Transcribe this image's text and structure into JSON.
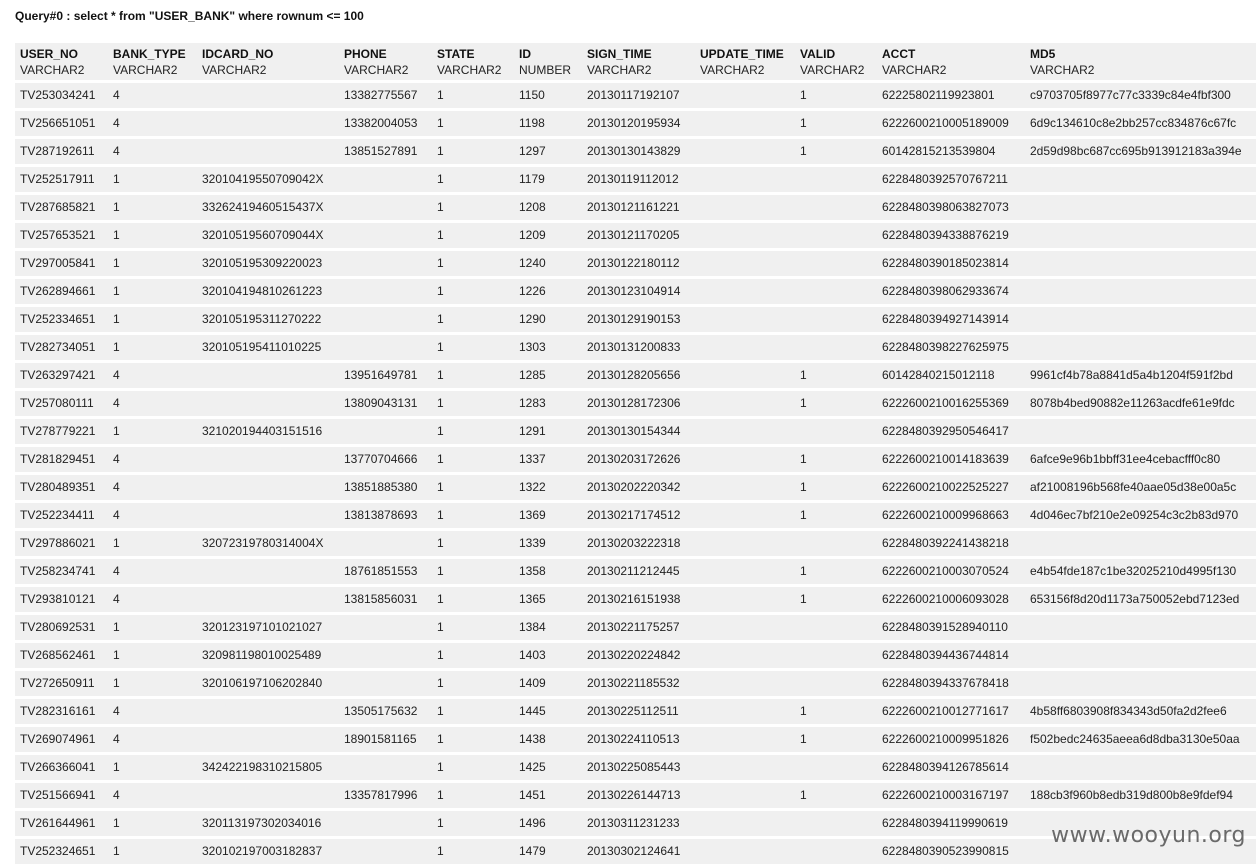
{
  "query": {
    "title": "Query#0 : select * from \"USER_BANK\" where rownum <= 100"
  },
  "table": {
    "columns": [
      {
        "name": "USER_NO",
        "type": "VARCHAR2"
      },
      {
        "name": "BANK_TYPE",
        "type": "VARCHAR2"
      },
      {
        "name": "IDCARD_NO",
        "type": "VARCHAR2"
      },
      {
        "name": "PHONE",
        "type": "VARCHAR2"
      },
      {
        "name": "STATE",
        "type": "VARCHAR2"
      },
      {
        "name": "ID",
        "type": "NUMBER"
      },
      {
        "name": "SIGN_TIME",
        "type": "VARCHAR2"
      },
      {
        "name": "UPDATE_TIME",
        "type": "VARCHAR2"
      },
      {
        "name": "VALID",
        "type": "VARCHAR2"
      },
      {
        "name": "ACCT",
        "type": "VARCHAR2"
      },
      {
        "name": "MD5",
        "type": "VARCHAR2"
      }
    ],
    "rows": [
      [
        "TV253034241",
        "4",
        "",
        "13382775567",
        "1",
        "1150",
        "20130117192107",
        "",
        "1",
        "62225802119923801",
        "c9703705f8977c77c3339c84e4fbf300"
      ],
      [
        "TV256651051",
        "4",
        "",
        "13382004053",
        "1",
        "1198",
        "20130120195934",
        "",
        "1",
        "6222600210005189009",
        "6d9c134610c8e2bb257cc834876c67fc"
      ],
      [
        "TV287192611",
        "4",
        "",
        "13851527891",
        "1",
        "1297",
        "20130130143829",
        "",
        "1",
        "60142815213539804",
        "2d59d98bc687cc695b913912183a394e"
      ],
      [
        "TV252517911",
        "1",
        "32010419550709042X",
        "",
        "1",
        "1179",
        "20130119112012",
        "",
        "",
        "6228480392570767211",
        ""
      ],
      [
        "TV287685821",
        "1",
        "33262419460515437X",
        "",
        "1",
        "1208",
        "20130121161221",
        "",
        "",
        "6228480398063827073",
        ""
      ],
      [
        "TV257653521",
        "1",
        "32010519560709044X",
        "",
        "1",
        "1209",
        "20130121170205",
        "",
        "",
        "6228480394338876219",
        ""
      ],
      [
        "TV297005841",
        "1",
        "320105195309220023",
        "",
        "1",
        "1240",
        "20130122180112",
        "",
        "",
        "6228480390185023814",
        ""
      ],
      [
        "TV262894661",
        "1",
        "320104194810261223",
        "",
        "1",
        "1226",
        "20130123104914",
        "",
        "",
        "6228480398062933674",
        ""
      ],
      [
        "TV252334651",
        "1",
        "320105195311270222",
        "",
        "1",
        "1290",
        "20130129190153",
        "",
        "",
        "6228480394927143914",
        ""
      ],
      [
        "TV282734051",
        "1",
        "320105195411010225",
        "",
        "1",
        "1303",
        "20130131200833",
        "",
        "",
        "6228480398227625975",
        ""
      ],
      [
        "TV263297421",
        "4",
        "",
        "13951649781",
        "1",
        "1285",
        "20130128205656",
        "",
        "1",
        "60142840215012118",
        "9961cf4b78a8841d5a4b1204f591f2bd"
      ],
      [
        "TV257080111",
        "4",
        "",
        "13809043131",
        "1",
        "1283",
        "20130128172306",
        "",
        "1",
        "6222600210016255369",
        "8078b4bed90882e11263acdfe61e9fdc"
      ],
      [
        "TV278779221",
        "1",
        "321020194403151516",
        "",
        "1",
        "1291",
        "20130130154344",
        "",
        "",
        "6228480392950546417",
        ""
      ],
      [
        "TV281829451",
        "4",
        "",
        "13770704666",
        "1",
        "1337",
        "20130203172626",
        "",
        "1",
        "6222600210014183639",
        "6afce9e96b1bbff31ee4cebacfff0c80"
      ],
      [
        "TV280489351",
        "4",
        "",
        "13851885380",
        "1",
        "1322",
        "20130202220342",
        "",
        "1",
        "6222600210022525227",
        "af21008196b568fe40aae05d38e00a5c"
      ],
      [
        "TV252234411",
        "4",
        "",
        "13813878693",
        "1",
        "1369",
        "20130217174512",
        "",
        "1",
        "6222600210009968663",
        "4d046ec7bf210e2e09254c3c2b83d970"
      ],
      [
        "TV297886021",
        "1",
        "32072319780314004X",
        "",
        "1",
        "1339",
        "20130203222318",
        "",
        "",
        "6228480392241438218",
        ""
      ],
      [
        "TV258234741",
        "4",
        "",
        "18761851553",
        "1",
        "1358",
        "20130211212445",
        "",
        "1",
        "6222600210003070524",
        "e4b54fde187c1be32025210d4995f130"
      ],
      [
        "TV293810121",
        "4",
        "",
        "13815856031",
        "1",
        "1365",
        "20130216151938",
        "",
        "1",
        "6222600210006093028",
        "653156f8d20d1173a750052ebd7123ed"
      ],
      [
        "TV280692531",
        "1",
        "320123197101021027",
        "",
        "1",
        "1384",
        "20130221175257",
        "",
        "",
        "6228480391528940110",
        ""
      ],
      [
        "TV268562461",
        "1",
        "320981198010025489",
        "",
        "1",
        "1403",
        "20130220224842",
        "",
        "",
        "6228480394436744814",
        ""
      ],
      [
        "TV272650911",
        "1",
        "320106197106202840",
        "",
        "1",
        "1409",
        "20130221185532",
        "",
        "",
        "6228480394337678418",
        ""
      ],
      [
        "TV282316161",
        "4",
        "",
        "13505175632",
        "1",
        "1445",
        "20130225112511",
        "",
        "1",
        "6222600210012771617",
        "4b58ff6803908f834343d50fa2d2fee6"
      ],
      [
        "TV269074961",
        "4",
        "",
        "18901581165",
        "1",
        "1438",
        "20130224110513",
        "",
        "1",
        "6222600210009951826",
        "f502bedc24635aeea6d8dba3130e50aa"
      ],
      [
        "TV266366041",
        "1",
        "342422198310215805",
        "",
        "1",
        "1425",
        "20130225085443",
        "",
        "",
        "6228480394126785614",
        ""
      ],
      [
        "TV251566941",
        "4",
        "",
        "13357817996",
        "1",
        "1451",
        "20130226144713",
        "",
        "1",
        "6222600210003167197",
        "188cb3f960b8edb319d800b8e9fdef94"
      ],
      [
        "TV261644961",
        "1",
        "320113197302034016",
        "",
        "1",
        "1496",
        "20130311231233",
        "",
        "",
        "6228480394119990619",
        ""
      ],
      [
        "TV252324651",
        "1",
        "320102197003182837",
        "",
        "1",
        "1479",
        "20130302124641",
        "",
        "",
        "6228480390523990815",
        ""
      ]
    ]
  },
  "watermark": {
    "text": "www.wooyun.org"
  }
}
